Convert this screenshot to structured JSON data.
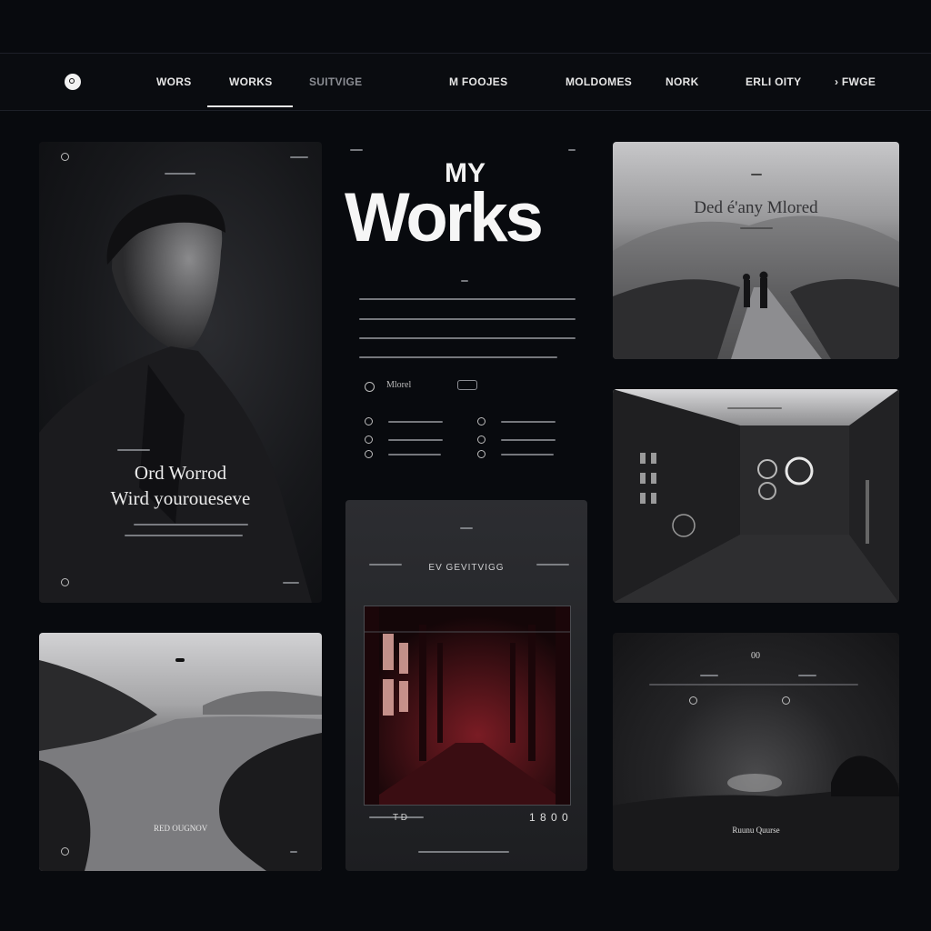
{
  "nav": {
    "items": [
      "WORS",
      "WORKS",
      "SUITVIGE",
      "M FOOJES",
      "MOLDOMES",
      "NORK",
      "ERLI OITY",
      "› FWGE"
    ]
  },
  "hero": {
    "line1": "MY",
    "line2": "Works",
    "author_label": "Mlorel"
  },
  "cards": {
    "portrait_caption_line1": "Ord Worrod",
    "portrait_caption_line2": "Wird youroueseve",
    "road_title": "Ded é'any Mlored",
    "project_title": "EV GEVITVIGG",
    "project_footer_left": "T D",
    "project_footer_right": "1 8 0 0",
    "lake_caption": "RED OUGNOV",
    "field_caption": "Ruunu Quurse",
    "field_badge": "00"
  },
  "colors": {
    "background": "#080a0e",
    "accent": "#8a1a22"
  }
}
